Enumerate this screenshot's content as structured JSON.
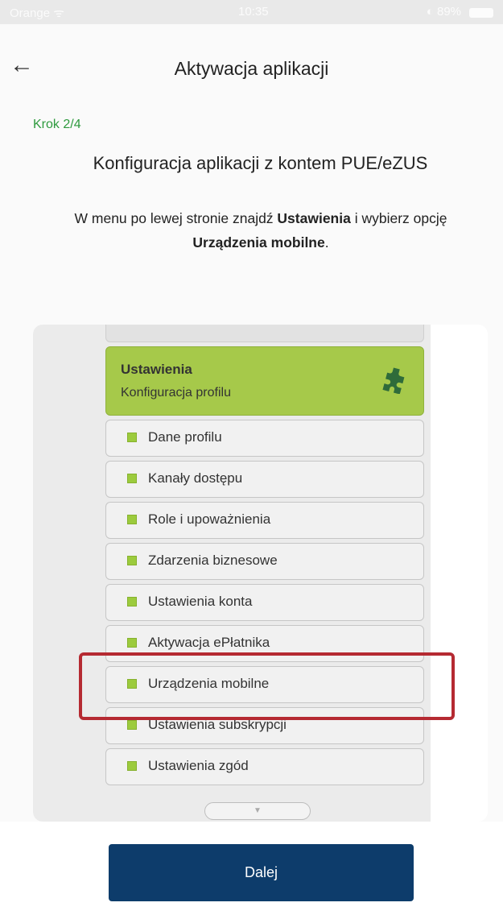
{
  "statusbar": {
    "carrier": "Orange ᯤ",
    "time": "10:35",
    "battery": "◐ 89%"
  },
  "header": {
    "back_icon": "arrow-left-icon",
    "title": "Aktywacja aplikacji"
  },
  "step": "Krok 2/4",
  "subtitle": "Konfiguracja aplikacji z kontem PUE/eZUS",
  "instructions": {
    "part1": "W menu po lewej stronie znajdź ",
    "bold1": "Ustawienia",
    "part2": " i wybierz opcję ",
    "bold2": "Urządzenia mobilne",
    "part3": "."
  },
  "panel": {
    "settings_title": "Ustawienia",
    "settings_subtitle": "Konfiguracja profilu",
    "settings_icon": "puzzle-icon",
    "items": [
      {
        "label": "Dane profilu"
      },
      {
        "label": "Kanały dostępu"
      },
      {
        "label": "Role i upoważnienia"
      },
      {
        "label": "Zdarzenia biznesowe"
      },
      {
        "label": "Ustawienia konta"
      },
      {
        "label": "Aktywacja ePłatnika"
      },
      {
        "label": "Urządzenia mobilne"
      },
      {
        "label": "Ustawienia subskrypcji"
      },
      {
        "label": "Ustawienia zgód"
      }
    ],
    "highlight_color": "#b52a32",
    "accent_green": "#a6c94a"
  },
  "footer": {
    "next_label": "Dalej",
    "button_color": "#0d3c6b"
  }
}
